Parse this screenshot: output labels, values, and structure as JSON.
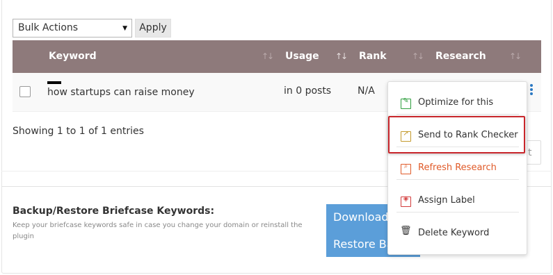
{
  "toolbar": {
    "bulk_select_value": "Bulk Actions",
    "apply_label": "Apply"
  },
  "table": {
    "columns": [
      "Keyword",
      "Usage",
      "Rank",
      "Research"
    ],
    "rows": [
      {
        "keyword": "how startups can raise money",
        "usage": "in 0 posts",
        "rank": "N/A"
      }
    ],
    "showing": "Showing 1 to 1 of 1 entries",
    "pagination_fragment": "t"
  },
  "backup": {
    "title": "Backup/Restore Briefcase Keywords:",
    "description": "Keep your briefcase keywords safe in case you change your domain or reinstall the plugin",
    "download_label": "Download",
    "restore_label": "Restore Ba"
  },
  "menu": {
    "items": [
      {
        "label": "Optimize for this",
        "icon": "edit-icon",
        "color": "#2e9e3e"
      },
      {
        "label": "Send to Rank Checker",
        "icon": "chart-icon",
        "color": "#c49a2c"
      },
      {
        "label": "Refresh Research",
        "icon": "search-icon",
        "color": "#e05a28"
      },
      {
        "label": "Assign Label",
        "icon": "tag-icon",
        "color": "#d33b3b"
      },
      {
        "label": "Delete Keyword",
        "icon": "trash-icon",
        "color": "#333333"
      }
    ]
  },
  "colors": {
    "table_header": "#8e7a7b",
    "accent_blue": "#5b9ed9",
    "highlight_red": "#c9262b"
  }
}
